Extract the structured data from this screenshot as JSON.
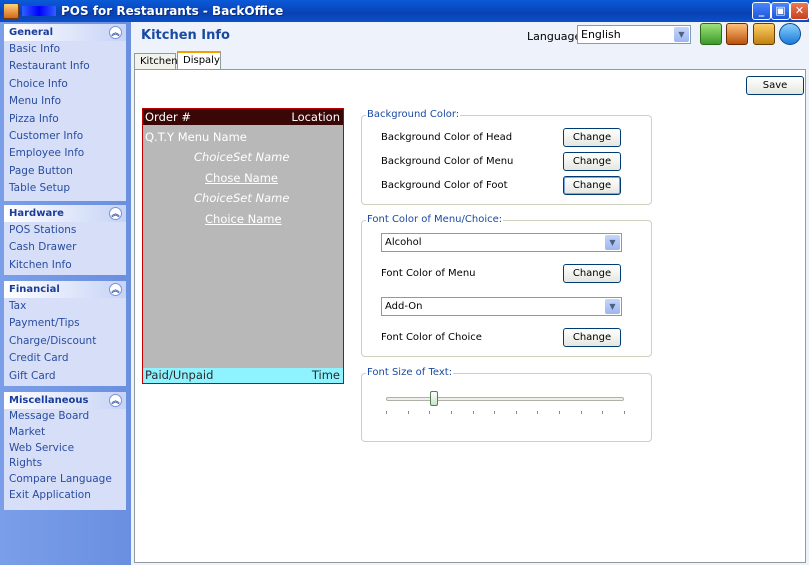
{
  "window": {
    "title": "POS for Restaurants - BackOffice"
  },
  "sidebar": {
    "groups": [
      {
        "title": "General",
        "items": [
          "Basic Info",
          "Restaurant Info",
          "Choice Info",
          "Menu Info",
          "Pizza Info",
          "Customer Info",
          "Employee Info",
          "Page Button",
          "Table Setup"
        ]
      },
      {
        "title": "Hardware",
        "items": [
          "POS Stations",
          "Cash Drawer",
          "Kitchen Info"
        ]
      },
      {
        "title": "Financial",
        "items": [
          "Tax",
          "Payment/Tips",
          "Charge/Discount",
          "Credit Card",
          "Gift Card"
        ]
      },
      {
        "title": "Miscellaneous",
        "items": [
          "Message Board",
          "Market",
          "Web Service",
          "Rights",
          "Compare Language",
          "Exit Application"
        ]
      }
    ]
  },
  "header": {
    "title": "Kitchen Info",
    "language_label": "Language:",
    "language_value": "English"
  },
  "tabs": [
    {
      "label": "Kitchen"
    },
    {
      "label": "Dispaly"
    }
  ],
  "panel": {
    "save_label": "Save",
    "preview": {
      "head_left": "Order #",
      "head_right": "Location",
      "qty_line": "Q.T.Y  Menu Name",
      "choiceset_1": "ChoiceSet Name",
      "choice_1": "Chose Name",
      "choiceset_2": "ChoiceSet Name",
      "choice_2": "Choice Name",
      "foot_left": "Paid/Unpaid",
      "foot_right": "Time"
    },
    "background_color": {
      "legend": "Background Color:",
      "rows": [
        {
          "label": "Background Color of Head",
          "button": "Change"
        },
        {
          "label": "Background Color of Menu",
          "button": "Change"
        },
        {
          "label": "Background Color of Foot",
          "button": "Change"
        }
      ]
    },
    "font_color": {
      "legend": "Font Color of Menu/Choice:",
      "menu_select": "Alcohol",
      "menu_label": "Font Color of Menu",
      "choice_select": "Add-On",
      "choice_label": "Font Color of Choice",
      "button": "Change"
    },
    "font_size": {
      "legend": "Font Size of Text:",
      "slider_fraction": 0.2
    }
  },
  "colors": {
    "preview_head": "#3a0707",
    "preview_body": "#b8b8b8",
    "preview_foot": "#8ff3ff",
    "accent": "#1a4aa0"
  }
}
